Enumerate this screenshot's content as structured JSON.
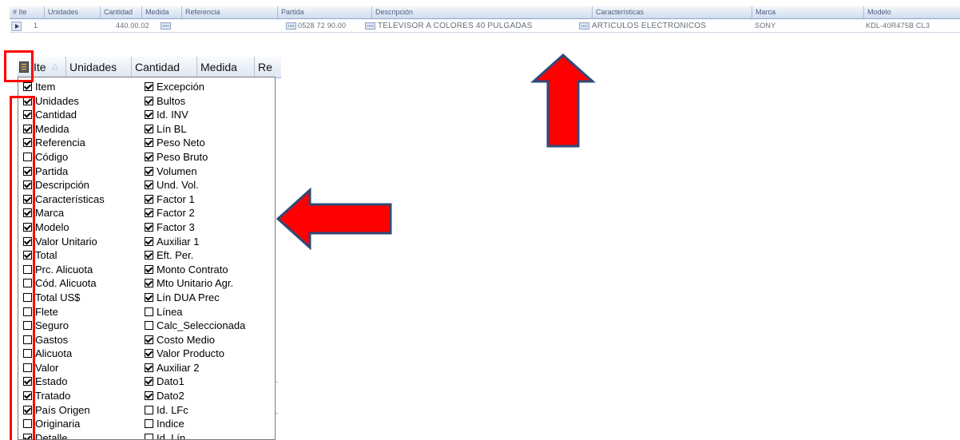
{
  "top_grid": {
    "headers": [
      "# Ite",
      "Unidades",
      "Cantidad",
      "Medida",
      "Referencia",
      "Partida",
      "Descripción",
      "Características",
      "Marca",
      "Modelo"
    ],
    "row": {
      "item": "1",
      "cantidad": "440.00.02",
      "partida": "0528 72 90.00",
      "descripcion": "TELEVISOR A COLORES 40 PULGADAS",
      "caracteristicas": "ARTICULOS ELECTRONICOS",
      "marca": "SONY",
      "modelo": "KDL-40R475B CL3"
    }
  },
  "grid2": {
    "headers": [
      "Ite",
      "Unidades",
      "Cantidad",
      "Medida",
      "Re"
    ]
  },
  "column_chooser": {
    "left": [
      {
        "label": "Item",
        "checked": true
      },
      {
        "label": "Unidades",
        "checked": true
      },
      {
        "label": "Cantidad",
        "checked": true
      },
      {
        "label": "Medida",
        "checked": true
      },
      {
        "label": "Referencia",
        "checked": true
      },
      {
        "label": "Código",
        "checked": false
      },
      {
        "label": "Partida",
        "checked": true
      },
      {
        "label": "Descripción",
        "checked": true
      },
      {
        "label": "Características",
        "checked": true
      },
      {
        "label": "Marca",
        "checked": true
      },
      {
        "label": "Modelo",
        "checked": true
      },
      {
        "label": "Valor Unitario",
        "checked": true
      },
      {
        "label": "Total",
        "checked": true
      },
      {
        "label": "Prc. Alicuota",
        "checked": false
      },
      {
        "label": "Cód. Alicuota",
        "checked": false
      },
      {
        "label": "Total US$",
        "checked": false
      },
      {
        "label": "Flete",
        "checked": false
      },
      {
        "label": "Seguro",
        "checked": false
      },
      {
        "label": "Gastos",
        "checked": false
      },
      {
        "label": "Alicuota",
        "checked": false
      },
      {
        "label": "Valor",
        "checked": false
      },
      {
        "label": "Estado",
        "checked": true
      },
      {
        "label": "Tratado",
        "checked": true
      },
      {
        "label": "País Origen",
        "checked": true
      },
      {
        "label": "Originaria",
        "checked": false
      },
      {
        "label": "Detalle",
        "checked": true
      }
    ],
    "right": [
      {
        "label": "Excepción",
        "checked": true
      },
      {
        "label": "Bultos",
        "checked": true
      },
      {
        "label": "Id. INV",
        "checked": true
      },
      {
        "label": "Lín BL",
        "checked": true
      },
      {
        "label": "Peso Neto",
        "checked": true
      },
      {
        "label": "Peso Bruto",
        "checked": true
      },
      {
        "label": "Volumen",
        "checked": true
      },
      {
        "label": "Und. Vol.",
        "checked": true
      },
      {
        "label": "Factor 1",
        "checked": true
      },
      {
        "label": "Factor 2",
        "checked": true
      },
      {
        "label": "Factor 3",
        "checked": true
      },
      {
        "label": "Auxiliar 1",
        "checked": true
      },
      {
        "label": "Eft. Per.",
        "checked": true
      },
      {
        "label": "Monto Contrato",
        "checked": true
      },
      {
        "label": "Mto Unitario Agr.",
        "checked": true
      },
      {
        "label": "Lín DUA Prec",
        "checked": true
      },
      {
        "label": "Línea",
        "checked": false
      },
      {
        "label": "Calc_Seleccionada",
        "checked": false
      },
      {
        "label": "Costo Medio",
        "checked": true
      },
      {
        "label": "Valor Producto",
        "checked": true
      },
      {
        "label": "Auxiliar 2",
        "checked": true
      },
      {
        "label": "Dato1",
        "checked": true
      },
      {
        "label": "Dato2",
        "checked": true
      },
      {
        "label": "Id. LFc",
        "checked": false
      },
      {
        "label": "Indice",
        "checked": false
      },
      {
        "label": "Id. Lín",
        "checked": false
      }
    ]
  },
  "colors": {
    "annotation": "#ff0000",
    "arrow_outline": "#2f4a78"
  }
}
